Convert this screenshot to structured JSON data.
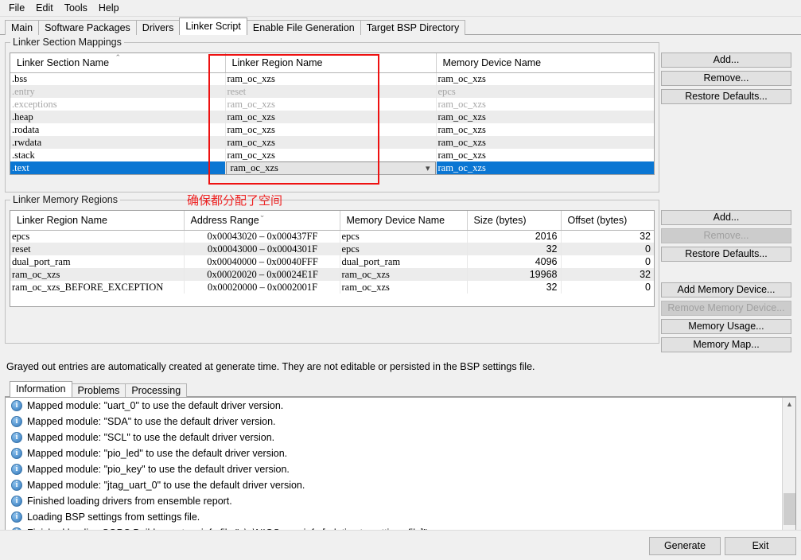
{
  "menu": {
    "items": [
      "File",
      "Edit",
      "Tools",
      "Help"
    ]
  },
  "tabs": {
    "items": [
      "Main",
      "Software Packages",
      "Drivers",
      "Linker Script",
      "Enable File Generation",
      "Target BSP Directory"
    ],
    "active": "Linker Script"
  },
  "section_mappings": {
    "legend": "Linker Section Mappings",
    "columns": [
      "Linker Section Name",
      "Linker Region Name",
      "Memory Device Name"
    ],
    "sort": {
      "column": "Linker Section Name",
      "direction": "ascending",
      "glyph": "⌃"
    },
    "rows": [
      {
        "section": ".bss",
        "region": "ram_oc_xzs",
        "device": "ram_oc_xzs",
        "grayed": false,
        "selected": false
      },
      {
        "section": ".entry",
        "region": "reset",
        "device": "epcs",
        "grayed": true,
        "selected": false
      },
      {
        "section": ".exceptions",
        "region": "ram_oc_xzs",
        "device": "ram_oc_xzs",
        "grayed": true,
        "selected": false
      },
      {
        "section": ".heap",
        "region": "ram_oc_xzs",
        "device": "ram_oc_xzs",
        "grayed": false,
        "selected": false
      },
      {
        "section": ".rodata",
        "region": "ram_oc_xzs",
        "device": "ram_oc_xzs",
        "grayed": false,
        "selected": false
      },
      {
        "section": ".rwdata",
        "region": "ram_oc_xzs",
        "device": "ram_oc_xzs",
        "grayed": false,
        "selected": false
      },
      {
        "section": ".stack",
        "region": "ram_oc_xzs",
        "device": "ram_oc_xzs",
        "grayed": false,
        "selected": false
      },
      {
        "section": ".text",
        "region": "ram_oc_xzs",
        "device": "ram_oc_xzs",
        "grayed": false,
        "selected": true
      }
    ],
    "buttons": [
      {
        "label": "Add...",
        "enabled": true
      },
      {
        "label": "Remove...",
        "enabled": true
      },
      {
        "label": "Restore Defaults...",
        "enabled": true
      }
    ]
  },
  "memory_regions": {
    "legend": "Linker Memory Regions",
    "columns": [
      "Linker Region Name",
      "Address Range",
      "Memory Device Name",
      "Size (bytes)",
      "Offset (bytes)"
    ],
    "sort": {
      "column": "Address Range",
      "direction": "descending",
      "glyph": "⌄"
    },
    "rows": [
      {
        "region": "epcs",
        "range": "0x00043020 – 0x000437FF",
        "device": "epcs",
        "size": "2016",
        "offset": "32"
      },
      {
        "region": "reset",
        "range": "0x00043000 – 0x0004301F",
        "device": "epcs",
        "size": "32",
        "offset": "0"
      },
      {
        "region": "dual_port_ram",
        "range": "0x00040000 – 0x00040FFF",
        "device": "dual_port_ram",
        "size": "4096",
        "offset": "0"
      },
      {
        "region": "ram_oc_xzs",
        "range": "0x00020020 – 0x00024E1F",
        "device": "ram_oc_xzs",
        "size": "19968",
        "offset": "32"
      },
      {
        "region": "ram_oc_xzs_BEFORE_EXCEPTION",
        "range": "0x00020000 – 0x0002001F",
        "device": "ram_oc_xzs",
        "size": "32",
        "offset": "0"
      }
    ],
    "buttons": [
      {
        "label": "Add...",
        "enabled": true
      },
      {
        "label": "Remove...",
        "enabled": false
      },
      {
        "label": "Restore Defaults...",
        "enabled": true
      },
      {
        "label": "Add Memory Device...",
        "enabled": true
      },
      {
        "label": "Remove Memory Device...",
        "enabled": false
      },
      {
        "label": "Memory Usage...",
        "enabled": true
      },
      {
        "label": "Memory Map...",
        "enabled": true
      }
    ]
  },
  "hint": "Grayed out entries are automatically created at generate time. They are not editable or persisted in the BSP settings file.",
  "log": {
    "tabs": [
      "Information",
      "Problems",
      "Processing"
    ],
    "active": "Information",
    "entries": [
      "Mapped module: \"uart_0\" to use the default driver version.",
      "Mapped module: \"SDA\" to use the default driver version.",
      "Mapped module: \"SCL\" to use the default driver version.",
      "Mapped module: \"pio_led\" to use the default driver version.",
      "Mapped module: \"pio_key\" to use the default driver version.",
      "Mapped module: \"jtag_uart_0\" to use the default driver version.",
      "Finished loading drivers from ensemble report.",
      "Loading BSP settings from settings file.",
      "Finished loading SOPC Builder system info file \"..\\..\\NIOS.sopcinfo [relative to settings file]\""
    ],
    "icon": "info-icon",
    "icon_glyph": "i"
  },
  "bottom": {
    "generate_label": "Generate",
    "exit_label": "Exit"
  },
  "annotation": {
    "text": "确保都分配了空间",
    "color": "#ee2222"
  }
}
